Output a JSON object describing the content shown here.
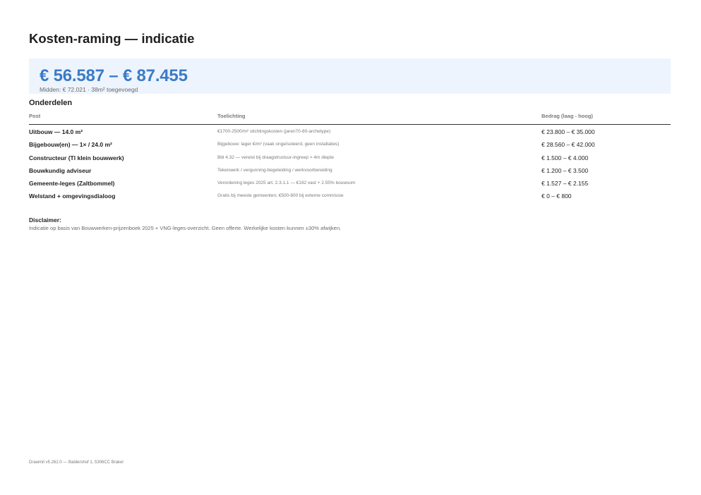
{
  "title": "Kosten-raming — indicatie",
  "summary": {
    "range": "€ 56.587 – € 87.455",
    "subtitle": "Midden: € 72.021 · 38m² toegevoegd"
  },
  "section_title": "Onderdelen",
  "table": {
    "headers": [
      "Post",
      "Toelichting",
      "Bedrag (laag - hoog)"
    ],
    "rows": [
      {
        "post": "Uitbouw — 14.0 m²",
        "toelichting": "€1700-2500/m² stichtingskosten (jaren70-80-archetype)",
        "bedrag": "€ 23.800 – € 35.000"
      },
      {
        "post": "Bijgebouw(en) — 1× / 24.0 m²",
        "toelichting": "Bijgebouw: lager €/m² (vaak ongeïsoleerd, geen installaties)",
        "bedrag": "€ 28.560 – € 42.000"
      },
      {
        "post": "Constructeur (Tl klein bouwwerk)",
        "toelichting": "Bbl 4.32 — vereist bij draagstructuur-ingreep > 4m diepte",
        "bedrag": "€ 1.500 – € 4.000"
      },
      {
        "post": "Bouwkundig adviseur",
        "toelichting": "Tekenwerk / vergunning-begeleiding / werkvoorbereiding",
        "bedrag": "€ 1.200 – € 3.500"
      },
      {
        "post": "Gemeente-leges (Zaltbommel)",
        "toelichting": "Verordening leges 2025 art. 2.3.1.1 — €192 vast + 2.55% bouwsom",
        "bedrag": "€ 1.527 – € 2.155"
      },
      {
        "post": "Welstand + omgevingsdialoog",
        "toelichting": "Gratis bij meeste gemeenten; €500-800 bij externe commissie",
        "bedrag": "€ 0 – € 800"
      }
    ]
  },
  "disclaimer": {
    "label": "Disclaimer:",
    "text": "Indicatie op basis van Bouwwerken-prijzenboek 2025 + VNG-leges-overzicht. Geen offerte. Werkelijke kosten kunnen ±30% afwijken."
  },
  "footer": "Drawmit v5.262.0 — Baldershof 1, 5306CC Brakel",
  "colors": {
    "accent": "#3a7bc8",
    "summary_bg": "#eef4fd"
  }
}
